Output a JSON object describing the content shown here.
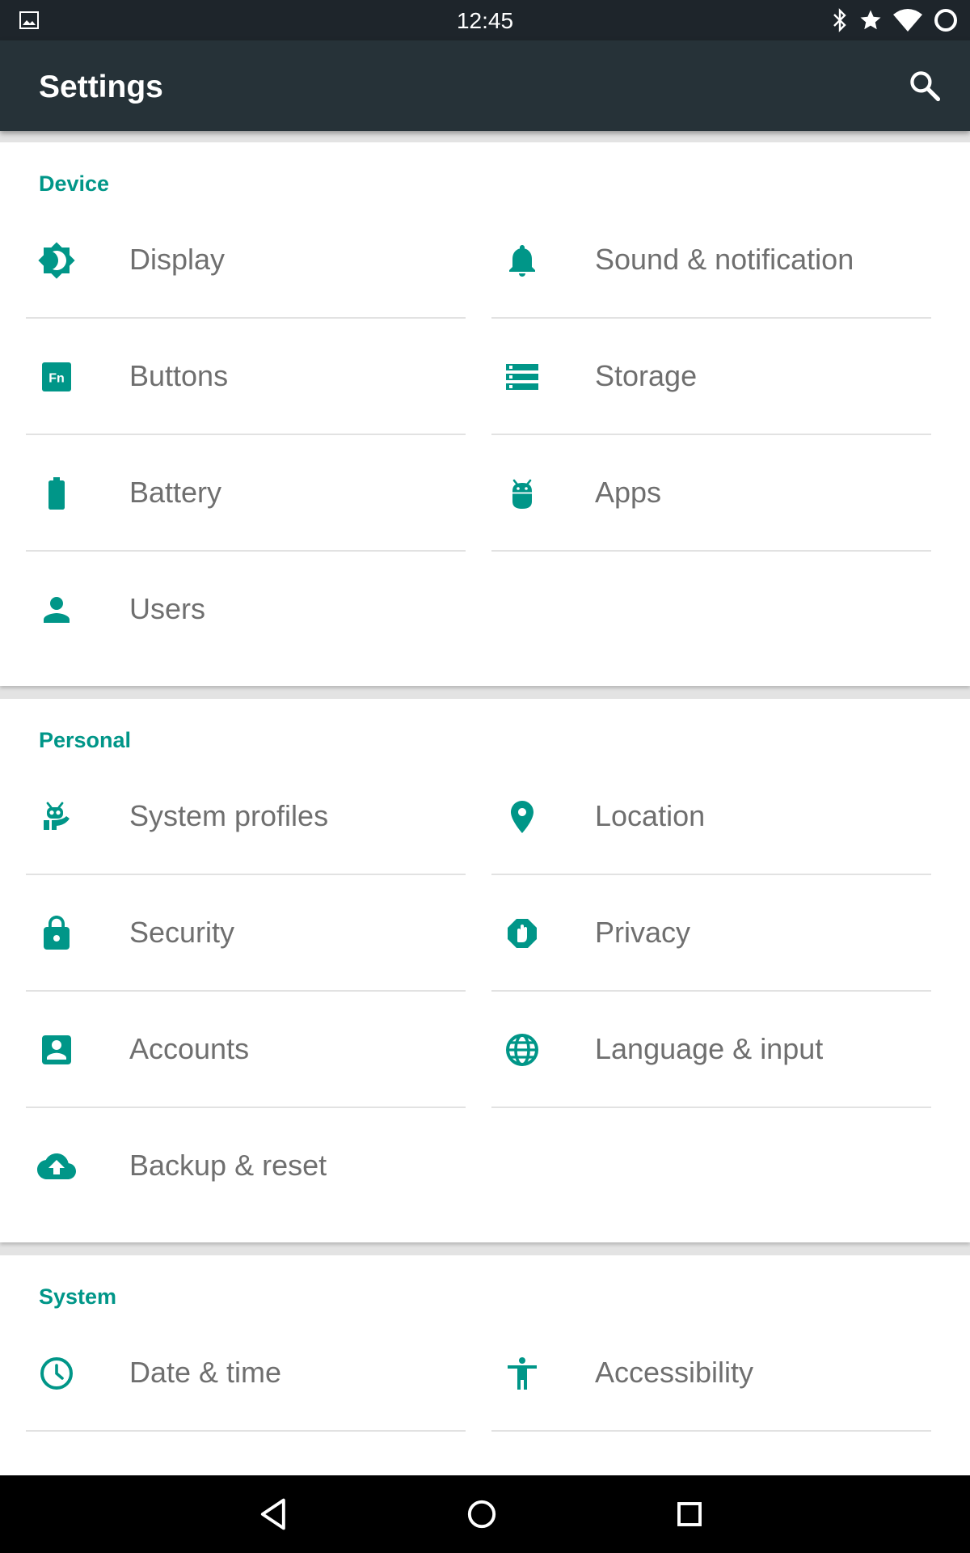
{
  "status_bar": {
    "time": "12:45",
    "icons": [
      "image-notification-icon",
      "bluetooth-icon",
      "star-icon",
      "wifi-icon",
      "battery-ring-icon"
    ]
  },
  "app_bar": {
    "title": "Settings",
    "search_icon": "search-icon"
  },
  "colors": {
    "accent": "#009688",
    "app_bar": "#263238",
    "status_bar": "#1e252b",
    "text": "#6f6f6f",
    "background": "#e3e3e3"
  },
  "sections": {
    "device": {
      "title": "Device",
      "items": [
        {
          "label": "Display",
          "icon": "brightness-icon"
        },
        {
          "label": "Sound & notification",
          "icon": "bell-icon"
        },
        {
          "label": "Buttons",
          "icon": "fn-key-icon"
        },
        {
          "label": "Storage",
          "icon": "storage-icon"
        },
        {
          "label": "Battery",
          "icon": "battery-icon"
        },
        {
          "label": "Apps",
          "icon": "android-icon"
        },
        {
          "label": "Users",
          "icon": "person-icon"
        }
      ]
    },
    "personal": {
      "title": "Personal",
      "items": [
        {
          "label": "System profiles",
          "icon": "profiles-robot-icon"
        },
        {
          "label": "Location",
          "icon": "location-pin-icon"
        },
        {
          "label": "Security",
          "icon": "lock-icon"
        },
        {
          "label": "Privacy",
          "icon": "privacy-hand-icon"
        },
        {
          "label": "Accounts",
          "icon": "account-box-icon"
        },
        {
          "label": "Language & input",
          "icon": "globe-icon"
        },
        {
          "label": "Backup & reset",
          "icon": "cloud-upload-icon"
        }
      ]
    },
    "system": {
      "title": "System",
      "items": [
        {
          "label": "Date & time",
          "icon": "clock-icon"
        },
        {
          "label": "Accessibility",
          "icon": "accessibility-icon"
        }
      ]
    }
  },
  "nav_bar": {
    "buttons": [
      "back-icon",
      "home-icon",
      "recents-icon"
    ]
  }
}
